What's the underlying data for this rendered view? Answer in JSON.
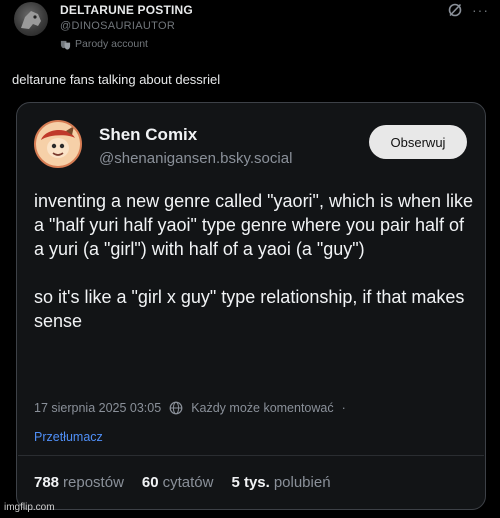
{
  "outer": {
    "display_name": "DELTARUNE POSTING",
    "handle": "@DINOSAURIAUTOR",
    "parody_label": "Parody account",
    "caption": "deltarune fans talking about dessriel"
  },
  "embedded_post": {
    "display_name": "Shen Comix",
    "handle": "@shenanigansen.bsky.social",
    "follow_label": "Obserwuj",
    "paragraphs": [
      "inventing a new genre called \"yaori\", which is when like a \"half yuri half yaoi\" type genre where you pair half of a yuri (a \"girl\") with half of a yaoi (a \"guy\")",
      "so it's like a \"girl x guy\" type relationship, if that makes sense"
    ],
    "timestamp": "17 sierpnia 2025 03:05",
    "reply_setting": "Każdy może komentować",
    "separator": "·",
    "translate_label": "Przetłumacz",
    "stats": [
      {
        "count": "788",
        "label": "repostów"
      },
      {
        "count": "60",
        "label": "cytatów"
      },
      {
        "count": "5 tys.",
        "label": "polubień"
      }
    ]
  },
  "watermark": "imgflip.com",
  "icons": {
    "parody": "masks-icon",
    "grok": "grok-icon",
    "more": "more-icon",
    "globe": "globe-icon"
  },
  "colors": {
    "background": "#000000",
    "card_background": "#121416",
    "link": "#4f8ff7",
    "muted": "#8a9099"
  }
}
